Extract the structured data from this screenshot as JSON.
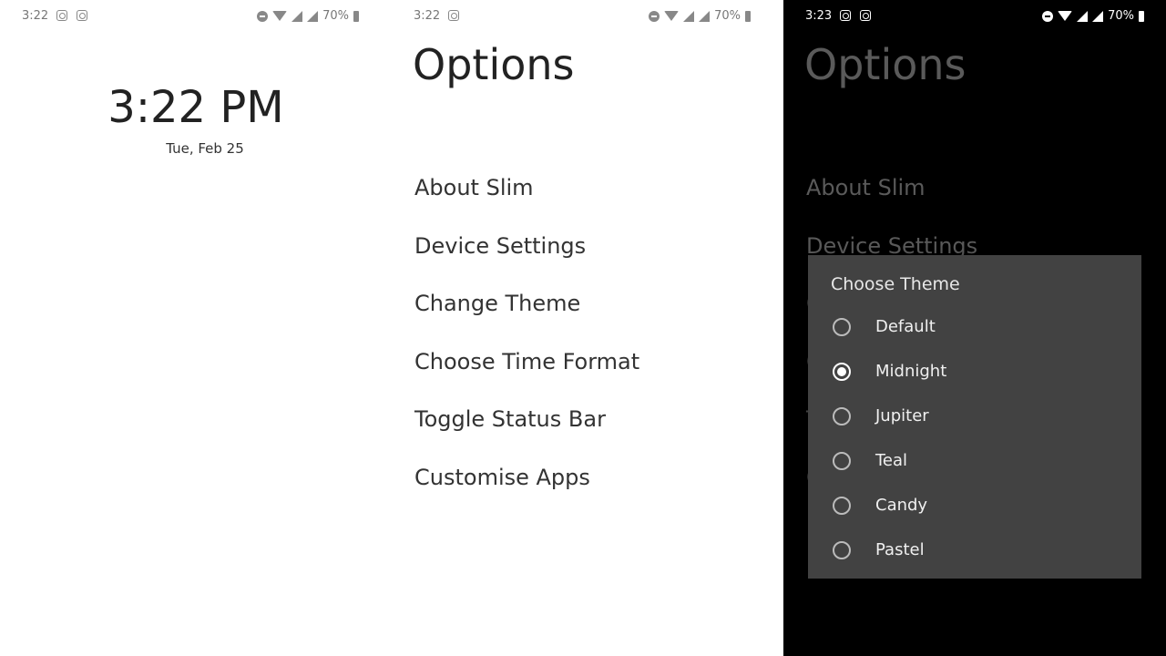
{
  "screens": [
    {
      "status_time": "3:22",
      "battery": "70%"
    },
    {
      "status_time": "3:22",
      "battery": "70%"
    },
    {
      "status_time": "3:23",
      "battery": "70%"
    }
  ],
  "home": {
    "clock": "3:22 PM",
    "date": "Tue, Feb 25"
  },
  "options": {
    "title": "Options",
    "items": [
      "About Slim",
      "Device Settings",
      "Change Theme",
      "Choose Time Format",
      "Toggle Status Bar",
      "Customise Apps"
    ]
  },
  "theme_dialog": {
    "title": "Choose Theme",
    "options": [
      "Default",
      "Midnight",
      "Jupiter",
      "Teal",
      "Candy",
      "Pastel"
    ],
    "selected": "Midnight"
  }
}
